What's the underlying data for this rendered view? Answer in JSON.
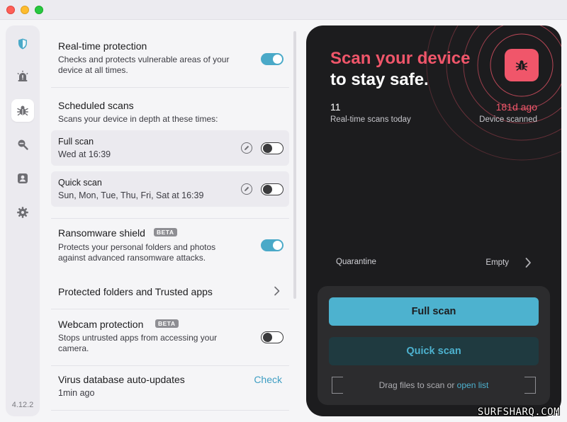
{
  "app": {
    "version": "4.12.2",
    "accent": "#4db2cf",
    "alert": "#f0566a"
  },
  "sidebar": {
    "items": [
      {
        "name": "shield",
        "icon": "shield-icon"
      },
      {
        "name": "alerts",
        "icon": "siren-icon"
      },
      {
        "name": "scan",
        "icon": "bug-icon",
        "active": true
      },
      {
        "name": "privacy",
        "icon": "magnifier-icon"
      },
      {
        "name": "identity",
        "icon": "user-badge-icon"
      },
      {
        "name": "settings",
        "icon": "gear-icon"
      }
    ]
  },
  "settings": {
    "realtime": {
      "title": "Real-time protection",
      "desc_line1": "Checks and protects vulnerable areas of your",
      "desc_line2": "device at all times.",
      "enabled": true
    },
    "scheduled": {
      "title": "Scheduled scans",
      "desc": "Scans your device in depth at these times:",
      "items": [
        {
          "title": "Full scan",
          "time": "Wed at 16:39",
          "enabled": false
        },
        {
          "title": "Quick scan",
          "time": "Sun, Mon, Tue, Thu, Fri, Sat at 16:39",
          "enabled": false
        }
      ]
    },
    "ransomware": {
      "title": "Ransomware shield",
      "badge": "BETA",
      "desc_line1": "Protects your personal folders and photos",
      "desc_line2": "against advanced ransomware attacks.",
      "enabled": true
    },
    "protected_folders": {
      "title": "Protected folders and Trusted apps"
    },
    "webcam": {
      "title": "Webcam protection",
      "badge": "BETA",
      "desc_line1": "Stops untrusted apps from accessing your",
      "desc_line2": "camera.",
      "enabled": false
    },
    "virus_db": {
      "title": "Virus database auto-updates",
      "subtitle": "1min ago",
      "action": "Check"
    }
  },
  "panel": {
    "headline_line1": "Scan your device",
    "headline_line2": "to stay safe.",
    "stat_left": {
      "value": "11",
      "label": "Real-time scans today"
    },
    "stat_right": {
      "value": "181d ago",
      "label": "Device scanned"
    },
    "quarantine": {
      "label": "Quarantine",
      "value": "Empty"
    },
    "full_scan_label": "Full scan",
    "quick_scan_label": "Quick scan",
    "dropzone": {
      "text": "Drag files to scan or ",
      "link": "open list"
    }
  },
  "watermark": "SURFSHARQ.COM"
}
